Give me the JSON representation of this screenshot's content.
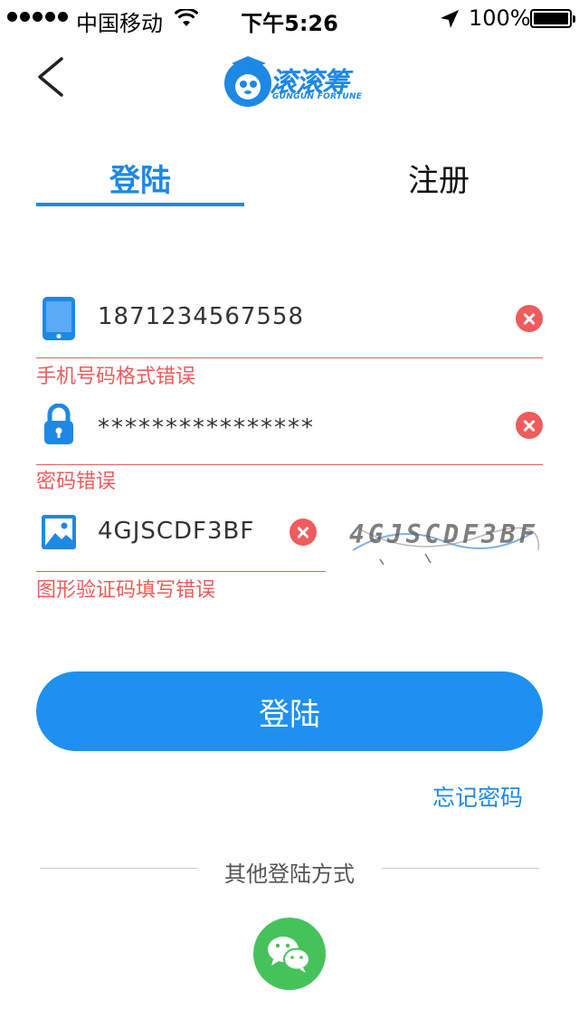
{
  "status_bar": {
    "carrier": "中国移动",
    "time": "下午5:26",
    "battery": "100%"
  },
  "header": {
    "logo_cn": "滚滚筹",
    "logo_en": "GUNGUN FORTUNE"
  },
  "tabs": {
    "login": "登陆",
    "register": "注册"
  },
  "form": {
    "phone": {
      "value": "1871234567558",
      "error": "手机号码格式错误"
    },
    "password": {
      "value": "****************",
      "error": "密码错误"
    },
    "captcha": {
      "value": "4GJSCDF3BF",
      "image_text": "4GJSCDF3BF",
      "error": "图形验证码填写错误"
    }
  },
  "login_button": "登陆",
  "forgot_password": "忘记密码",
  "other_login": "其他登陆方式",
  "colors": {
    "accent": "#1e88e5",
    "error": "#f05b5b",
    "wechat": "#45c35a"
  },
  "icons": [
    "back-icon",
    "phone-icon",
    "lock-icon",
    "image-icon",
    "clear-icon",
    "wechat-icon"
  ]
}
